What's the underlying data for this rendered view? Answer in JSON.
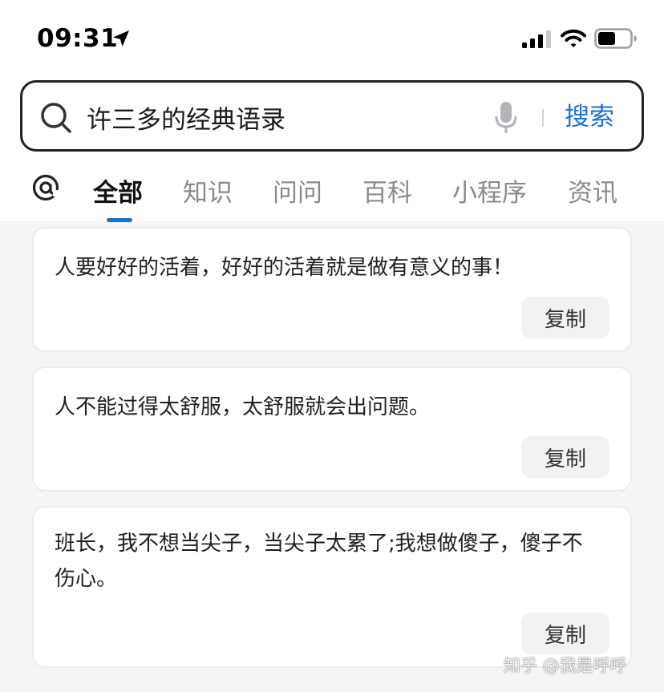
{
  "status_bar": {
    "time": "09:31",
    "icons": [
      "location-arrow-icon",
      "signal-icon",
      "wifi-icon",
      "battery-icon"
    ]
  },
  "search": {
    "query": "许三多的经典语录",
    "button_label": "搜索",
    "icons": [
      "search-icon",
      "microphone-icon"
    ]
  },
  "tabs": {
    "icon": "at-sign-icon",
    "items": [
      {
        "label": "全部",
        "active": true
      },
      {
        "label": "知识",
        "active": false
      },
      {
        "label": "问问",
        "active": false
      },
      {
        "label": "百科",
        "active": false
      },
      {
        "label": "小程序",
        "active": false
      },
      {
        "label": "资讯",
        "active": false
      }
    ]
  },
  "cards": [
    {
      "text": "人要好好的活着，好好的活着就是做有意义的事！",
      "copy_label": "复制"
    },
    {
      "text": "人不能过得太舒服，太舒服就会出问题。",
      "copy_label": "复制"
    },
    {
      "text": "班长，我不想当尖子，当尖子太累了;我想做傻子，傻子不伤心。",
      "copy_label": "复制"
    }
  ],
  "watermark": "知乎 @我是呼呼",
  "colors": {
    "accent": "#1b6fd6",
    "content_background": "#f5f5f7",
    "copy_button_background": "#f2f2f4"
  }
}
